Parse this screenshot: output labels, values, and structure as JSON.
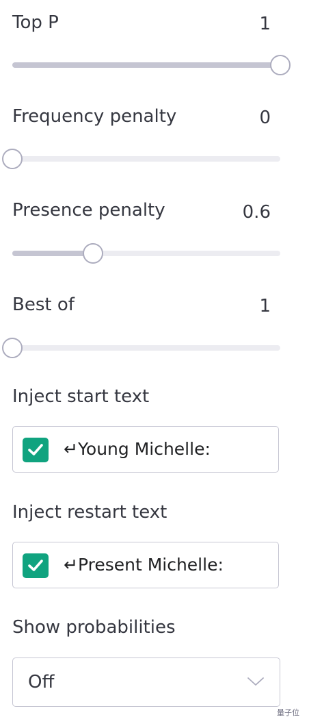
{
  "sliders": [
    {
      "id": "top-p",
      "label": "Top P",
      "value": "1",
      "fraction": 1.0
    },
    {
      "id": "frequency-penalty",
      "label": "Frequency penalty",
      "value": "0",
      "fraction": 0.0
    },
    {
      "id": "presence-penalty",
      "label": "Presence penalty",
      "value": "0.6",
      "fraction": 0.3
    },
    {
      "id": "best-of",
      "label": "Best of",
      "value": "1",
      "fraction": 0.0
    }
  ],
  "inject_start": {
    "label": "Inject start text",
    "checked": true,
    "text": "↵Young Michelle:"
  },
  "inject_restart": {
    "label": "Inject restart text",
    "checked": true,
    "text": "↵Present Michelle:"
  },
  "show_probabilities": {
    "label": "Show probabilities",
    "value": "Off"
  },
  "watermark": "量子位",
  "colors": {
    "accent": "#10a37f",
    "track": "#ececf1",
    "track_fill": "#c5c5d2",
    "thumb_border": "#acacbe"
  }
}
